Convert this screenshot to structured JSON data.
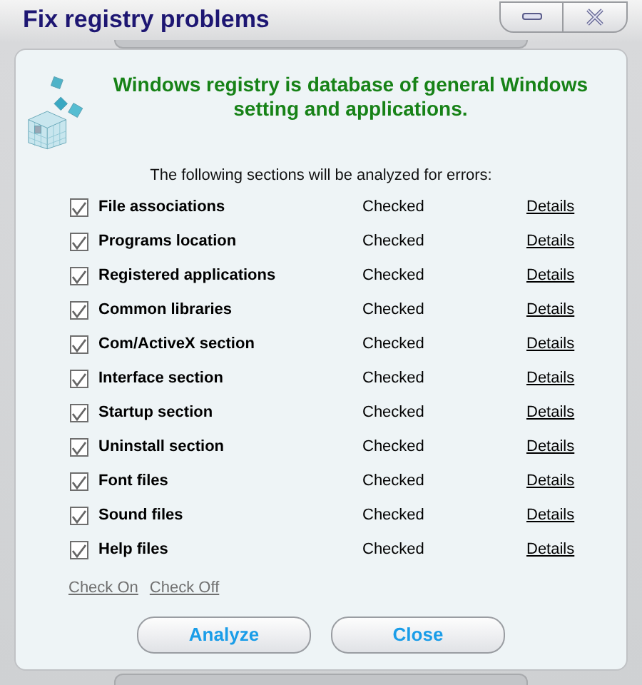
{
  "window": {
    "title": "Fix registry problems"
  },
  "header": "Windows registry is database of general Windows setting and applications.",
  "intro": "The following sections will be analyzed for errors:",
  "sections": [
    {
      "label": "File associations",
      "checked": true,
      "status": "Checked",
      "link": "Details"
    },
    {
      "label": "Programs location",
      "checked": true,
      "status": "Checked",
      "link": "Details"
    },
    {
      "label": "Registered applications",
      "checked": true,
      "status": "Checked",
      "link": "Details"
    },
    {
      "label": "Common libraries",
      "checked": true,
      "status": "Checked",
      "link": "Details"
    },
    {
      "label": "Com/ActiveX section",
      "checked": true,
      "status": "Checked",
      "link": "Details"
    },
    {
      "label": "Interface section",
      "checked": true,
      "status": "Checked",
      "link": "Details"
    },
    {
      "label": "Startup section",
      "checked": true,
      "status": "Checked",
      "link": "Details"
    },
    {
      "label": "Uninstall section",
      "checked": true,
      "status": "Checked",
      "link": "Details"
    },
    {
      "label": "Font files",
      "checked": true,
      "status": "Checked",
      "link": "Details"
    },
    {
      "label": "Sound files",
      "checked": true,
      "status": "Checked",
      "link": "Details"
    },
    {
      "label": "Help files",
      "checked": true,
      "status": "Checked",
      "link": "Details"
    }
  ],
  "check_links": [
    "Check On",
    "Check Off"
  ],
  "buttons": [
    "Analyze",
    "Close"
  ]
}
